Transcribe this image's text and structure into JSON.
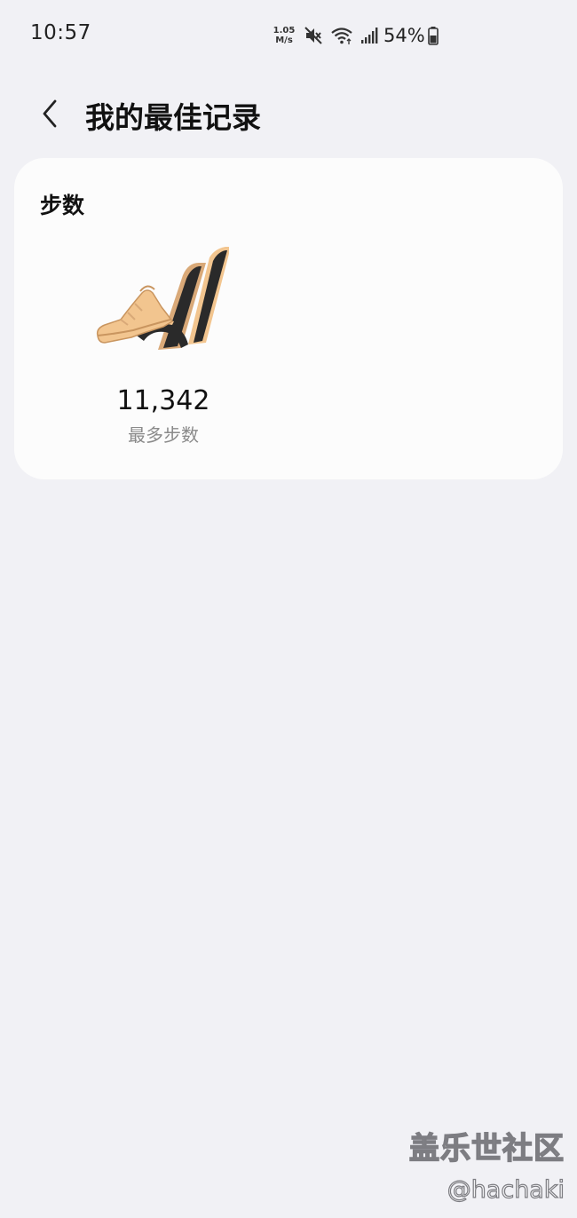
{
  "status_bar": {
    "time": "10:57",
    "net_speed_value": "1.05",
    "net_speed_unit": "M/s",
    "icons": [
      "mute-icon",
      "wifi-icon",
      "signal-icon",
      "battery-icon"
    ],
    "battery_percent": "54%"
  },
  "header": {
    "back_icon": "chevron-left-icon",
    "title": "我的最佳记录"
  },
  "card": {
    "title": "步数",
    "record": {
      "badge_icon": "shoe-badge-icon",
      "value": "11,342",
      "label": "最多步数"
    }
  },
  "watermark": {
    "title": "盖乐世社区",
    "handle": "@hachaki"
  },
  "colors": {
    "background": "#f1f1f5",
    "card": "#fcfcfc",
    "badge_gold": "#f2c58f",
    "badge_dark": "#2a2a2a",
    "secondary_text": "#8a8a8a"
  }
}
